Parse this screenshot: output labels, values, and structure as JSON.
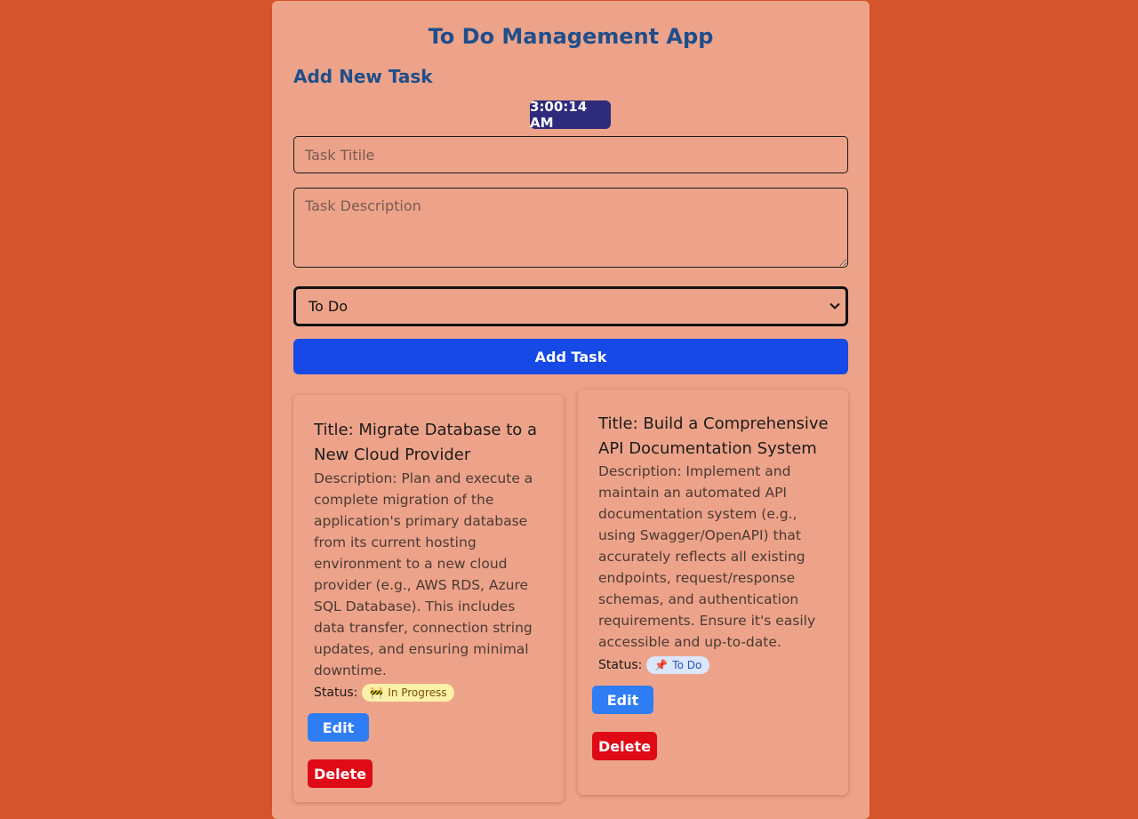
{
  "app": {
    "title": "To Do Management App"
  },
  "form": {
    "section_title": "Add New Task",
    "clock": "3:00:14 AM",
    "title_placeholder": "Task Titile",
    "description_placeholder": "Task Description",
    "status_selected": "To Do",
    "add_button": "Add Task"
  },
  "tasks": [
    {
      "title": "Title: Migrate Database to a New Cloud Provider",
      "description": "Description: Plan and execute a complete migration of the application's primary database from its current hosting environment to a new cloud provider (e.g., AWS RDS, Azure SQL Database). This includes data transfer, connection string updates, and ensuring minimal downtime.",
      "status_label": "Status:",
      "status_icon": "🚧",
      "status": "In Progress",
      "edit_label": "Edit",
      "delete_label": "Delete"
    },
    {
      "title": "Title: Build a Comprehensive API Documentation System",
      "description": "Description: Implement and maintain an automated API documentation system (e.g., using Swagger/OpenAPI) that accurately reflects all existing endpoints, request/response schemas, and authentication requirements. Ensure it's easily accessible and up-to-date.",
      "status_label": "Status:",
      "status_icon": "📌",
      "status": "To Do",
      "edit_label": "Edit",
      "delete_label": "Delete"
    }
  ],
  "colors": {
    "page_background": "#d4542b",
    "panel_background": "#eda389",
    "heading": "#1f4e8c",
    "clock_background": "#2e2a7c",
    "add_button": "#1649e5",
    "edit_button": "#2f7df5",
    "delete_button": "#e00a17"
  }
}
